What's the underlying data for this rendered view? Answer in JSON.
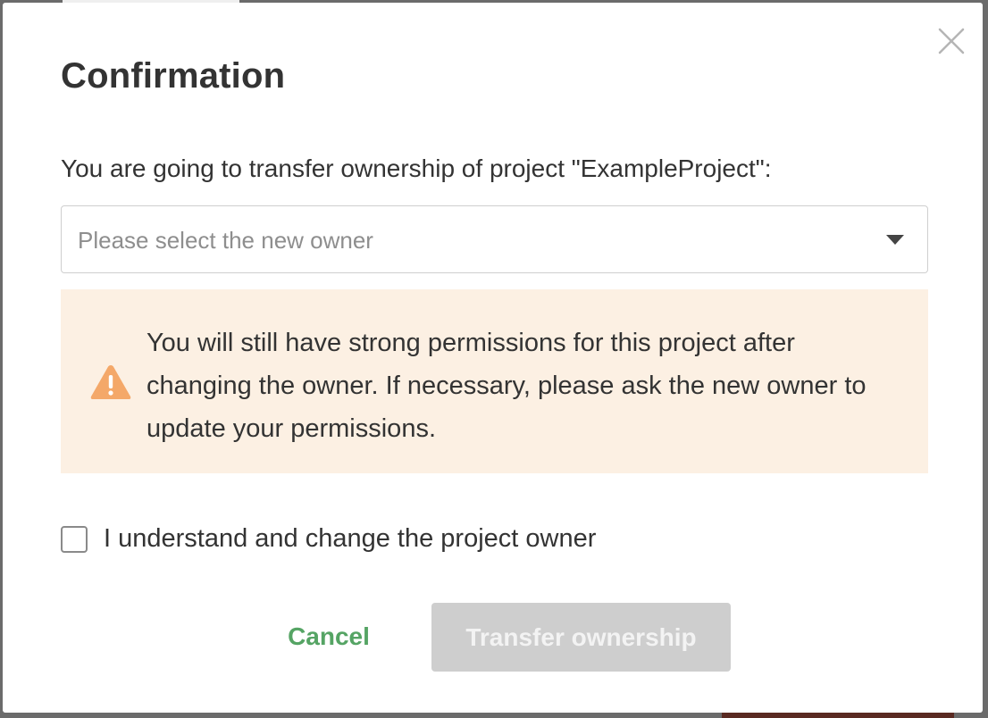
{
  "dialog": {
    "title": "Confirmation",
    "intro_text": "You are going to transfer ownership of project \"ExampleProject\":",
    "close_icon": "close-icon"
  },
  "owner_select": {
    "placeholder": "Please select the new owner",
    "caret_icon": "caret-down-icon"
  },
  "warning": {
    "icon": "warning-triangle-icon",
    "icon_color": "#f4a869",
    "background_color": "#fcf0e3",
    "text": "You will still have strong permissions for this project after changing the owner. If necessary, please ask the new owner to update your permissions."
  },
  "confirm": {
    "checked": false,
    "label": "I understand and change the project owner"
  },
  "actions": {
    "cancel_label": "Cancel",
    "cancel_color": "#55a464",
    "transfer_label": "Transfer ownership",
    "transfer_disabled": true
  }
}
